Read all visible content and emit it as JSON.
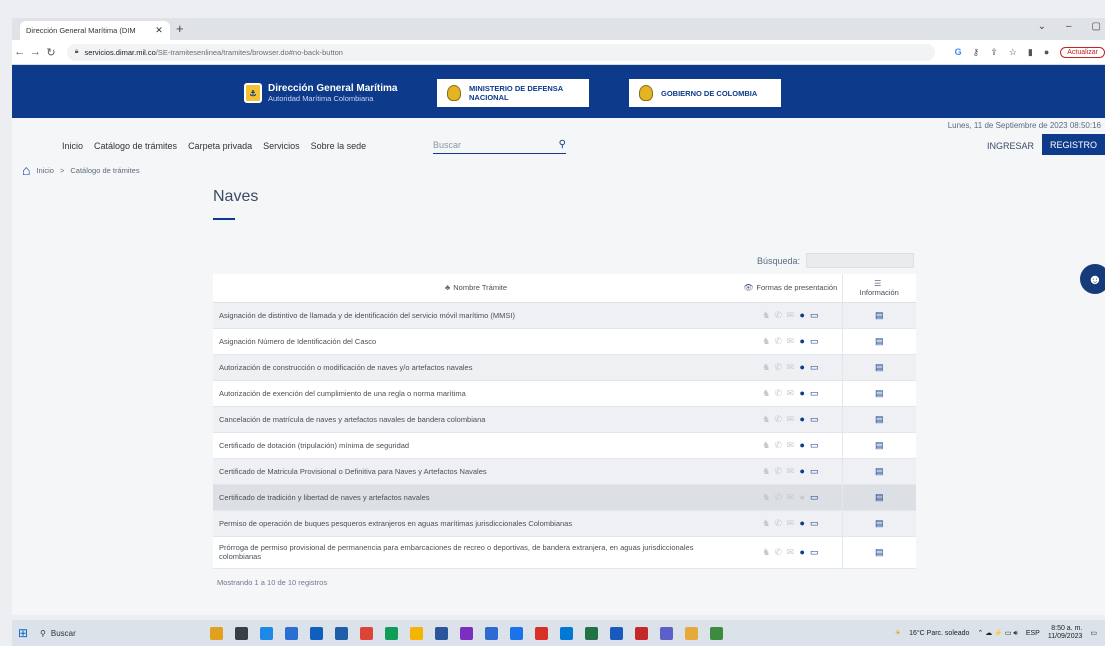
{
  "browser": {
    "tab_title": "Dirección General Marítima (DIM",
    "tab_close": "✕",
    "new_tab": "+",
    "url_host": "servicios.dimar.mil.co",
    "url_path": "/SE-tramitesenlinea/tramites/browser.do#no-back-button",
    "update_label": "Actualizar"
  },
  "header": {
    "brand_title": "Dirección General Marítima",
    "brand_sub": "Autoridad Marítima Colombiana",
    "ministry_line1": "MINISTERIO DE DEFENSA",
    "ministry_line2": "NACIONAL",
    "gov": "GOBIERNO DE COLOMBIA"
  },
  "date": "Lunes, 11 de Septiembre de 2023 08:50:16",
  "nav": [
    "Inicio",
    "Catálogo de trámites",
    "Carpeta privada",
    "Servicios",
    "Sobre la sede"
  ],
  "search": {
    "placeholder": "Buscar"
  },
  "auth": {
    "login": "INGRESAR",
    "register": "REGISTRO"
  },
  "breadcrumb": {
    "home": "Inicio",
    "sep": ">",
    "current": "Catálogo de trámites"
  },
  "page": {
    "title": "Naves",
    "search_label": "Búsqueda:"
  },
  "table": {
    "col_name": "Nombre Trámite",
    "col_formas": "Formas de presentación",
    "col_info": "Información",
    "rows": [
      {
        "name": "Asignación de distintivo de llamada y de identificación del servicio móvil marítimo (MMSI)"
      },
      {
        "name": "Asignación Número de Identificación del Casco"
      },
      {
        "name": "Autorización de construcción o modificación de naves y/o artefactos navales"
      },
      {
        "name": "Autorización de exención del cumplimiento de una regla o norma marítima"
      },
      {
        "name": "Cancelación de matrícula de naves y artefactos navales de bandera colombiana"
      },
      {
        "name": "Certificado de dotación (tripulación) mínima de seguridad"
      },
      {
        "name": "Certificado de Matricula Provisional o Definitiva para Naves y Artefactos Navales"
      },
      {
        "name": "Certificado de tradición y libertad de naves y artefactos navales"
      },
      {
        "name": "Permiso de operación de buques pesqueros extranjeros en aguas marítimas jurisdiccionales Colombianas"
      },
      {
        "name": "Prórroga de permiso provisional de permanencia para embarcaciones de recreo o deportivas, de bandera extranjera, en aguas jurisdiccionales colombianas"
      }
    ],
    "footer": "Mostrando 1 a 10 de 10 registros"
  },
  "taskbar": {
    "search": "Buscar",
    "weather": "16°C Parc. soleado",
    "lang": "ESP",
    "time": "8:50 a. m.",
    "date": "11/09/2023"
  },
  "colors": {
    "primary": "#0d3a8a",
    "seal": "#f3c234"
  }
}
